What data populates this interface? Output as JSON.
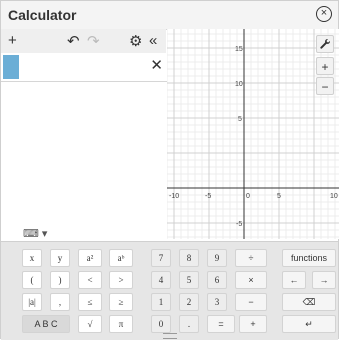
{
  "window": {
    "title": "Calculator"
  },
  "expression_toolbar": {
    "add_label": "+",
    "undo_label": "↶",
    "redo_label": "↷",
    "settings_label": "⚙",
    "collapse_label": "«"
  },
  "expression": {
    "value": "",
    "delete_label": "✕"
  },
  "graph": {
    "x_ticks": [
      "-10",
      "-5",
      "0",
      "5",
      "10"
    ],
    "y_ticks": [
      "15",
      "10",
      "5",
      "-5"
    ],
    "tools": {
      "wrench": "🔧",
      "zoom_in": "+",
      "zoom_out": "−"
    }
  },
  "keyboard_toggle": "⌨ ▾",
  "keypad": {
    "row1": [
      "x",
      "y",
      "a²",
      "aᵇ",
      "7",
      "8",
      "9",
      "÷",
      "functions"
    ],
    "row2": [
      "(",
      ")",
      "<",
      ">",
      "4",
      "5",
      "6",
      "×",
      "←",
      "→"
    ],
    "row3": [
      "|a|",
      ",",
      "≤",
      "≥",
      "1",
      "2",
      "3",
      "−",
      "⌫"
    ],
    "row4": [
      "A B C",
      "√",
      "π",
      "0",
      ".",
      "=",
      "+",
      "↵"
    ]
  }
}
